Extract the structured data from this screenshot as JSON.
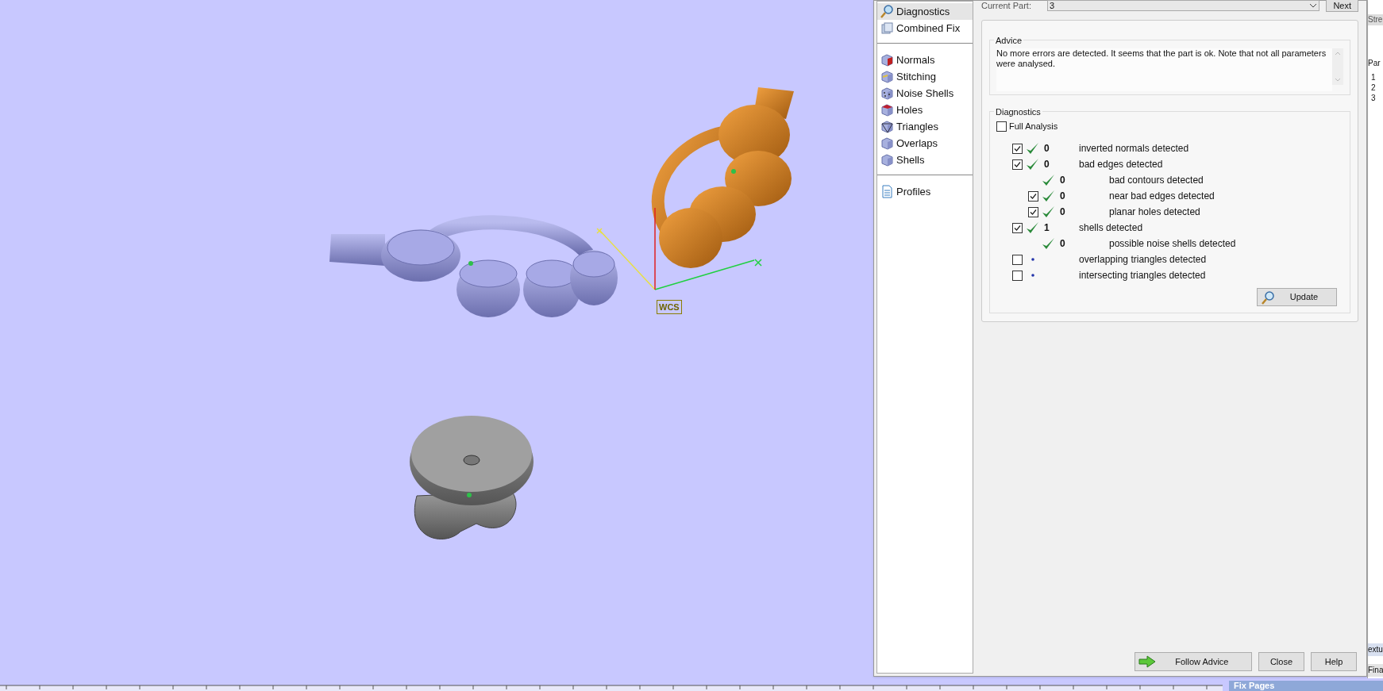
{
  "viewport": {
    "axis_label": "WCS"
  },
  "dialog": {
    "sidebar": [
      [
        {
          "label": "Diagnostics",
          "selected": true
        },
        {
          "label": "Combined Fix",
          "selected": false
        }
      ],
      [
        {
          "label": "Normals",
          "selected": false
        },
        {
          "label": "Stitching",
          "selected": false
        },
        {
          "label": "Noise Shells",
          "selected": false
        },
        {
          "label": "Holes",
          "selected": false
        },
        {
          "label": "Triangles",
          "selected": false
        },
        {
          "label": "Overlaps",
          "selected": false
        },
        {
          "label": "Shells",
          "selected": false
        }
      ],
      [
        {
          "label": "Profiles",
          "selected": false
        }
      ]
    ],
    "current_part": {
      "label": "Current Part:",
      "value": "3"
    },
    "next_button": "Next",
    "advice": {
      "title": "Advice",
      "text": "No more errors are detected. It seems that the part is ok. Note that not all parameters were analysed."
    },
    "diagnostics": {
      "title": "Diagnostics",
      "full_analysis": {
        "label": "Full Analysis",
        "checked": false
      },
      "rows": [
        {
          "kind": "checkbox",
          "checked": true,
          "passed": true,
          "count": "0",
          "label": "inverted normals detected"
        },
        {
          "kind": "checkbox",
          "checked": true,
          "passed": true,
          "count": "0",
          "label": "bad edges detected",
          "children": [
            {
              "kind": "plain",
              "passed": true,
              "count": "0",
              "label": "bad contours detected"
            },
            {
              "kind": "checkbox",
              "checked": true,
              "passed": true,
              "count": "0",
              "label": "near bad edges detected"
            },
            {
              "kind": "checkbox",
              "checked": true,
              "passed": true,
              "count": "0",
              "label": "planar holes detected"
            }
          ]
        },
        {
          "kind": "checkbox",
          "checked": true,
          "passed": true,
          "count": "1",
          "label": "shells detected",
          "children": [
            {
              "kind": "plain",
              "passed": true,
              "count": "0",
              "label": "possible noise shells detected"
            }
          ]
        },
        {
          "kind": "checkbox",
          "checked": false,
          "passed": false,
          "label": "overlapping triangles detected"
        },
        {
          "kind": "checkbox",
          "checked": false,
          "passed": false,
          "label": "intersecting triangles detected"
        }
      ],
      "update_button": "Update"
    },
    "buttons": [
      {
        "kind": "follow",
        "label": "Follow Advice"
      },
      {
        "kind": "plain",
        "label": "Close"
      },
      {
        "kind": "plain",
        "label": "Help"
      }
    ]
  },
  "side_panel": {
    "tab": "Stre",
    "column": "Par",
    "rows": [
      "1",
      "2",
      "3"
    ],
    "tab_2": "extu",
    "tab_3": "Fina",
    "title": "Fix Pages"
  }
}
